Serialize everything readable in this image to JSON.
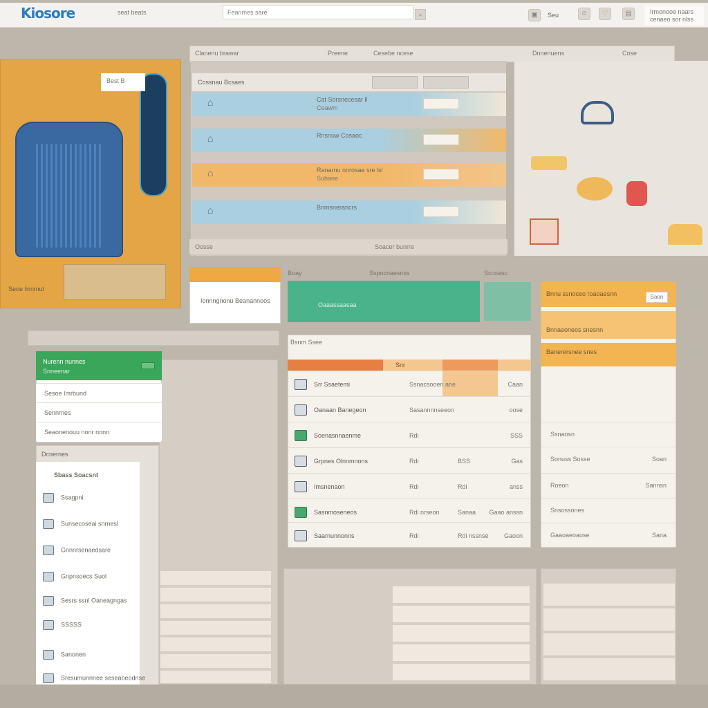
{
  "header": {
    "logo": "Kiosore",
    "top_link": "seat beats",
    "search_placeholder": "Feanmes sare",
    "account_line1": "Irmonooe naars",
    "account_line2": "cenaeo sor nlss"
  },
  "promo": {
    "label": "Best B",
    "footer": "Seoe Irrnmut"
  },
  "deals": {
    "tabs": [
      "Clanenu brawar",
      "Preene",
      "Cesebe ncese",
      "Dnnenuens",
      "Cose"
    ],
    "header": "Cossnau Bcsaes",
    "items": [
      {
        "title": "Cat Sorsnecesar ll",
        "sub": "Ceawm",
        "style": "blue"
      },
      {
        "title": "Rnsnuw Cosaoc",
        "sub": "",
        "style": "blue2"
      },
      {
        "title": "Ranarnu onrosae sre lsl",
        "sub": "Suhane",
        "style": "orange"
      },
      {
        "title": "Bnmsnerancrs",
        "sub": "",
        "style": "blue"
      }
    ],
    "footer_left": "Oosse",
    "footer_mid": "Soacer bunrre"
  },
  "cards": {
    "orange_card_text": "Ionnngnonu Beanannoos",
    "labels": [
      "Boay",
      "Sspocnaesnss",
      "Sccnasc"
    ],
    "teal_text": "Oaaassaasaa"
  },
  "list_card": {
    "title": "Nurenn nunnes",
    "subtitle": "Snneenar",
    "rows": [
      "Sesoe Imrbund",
      "Sennrnes",
      "Seaonenouu nonr nnnn"
    ]
  },
  "categories": {
    "title": "Dcnernes",
    "heading": "Sbass Soacsnt",
    "items": [
      "Ssagpni",
      "Sunsecoseai snrnesl",
      "Gnnnrsenaedsare",
      "Gnpnsoecs Suol",
      "Sesrs ssnl Oaneagngas",
      "SSSSS",
      "Sanonen",
      "Sresumunnnee seseaoeodnse"
    ]
  },
  "table": {
    "title": "Bsnm Ssee",
    "head_highlight": "Snr",
    "rows": [
      {
        "name": "Srr Ssaetemi",
        "c2": "Ssnacsooen ane",
        "c3": "",
        "c4": "Caan"
      },
      {
        "name": "Oanaan Banegeon",
        "c2": "Sasannnnseeon",
        "c3": "",
        "c4": "oose"
      },
      {
        "name": "Soenasnnaenme",
        "c2": "Rdi",
        "c3": "",
        "c4": "SSS"
      },
      {
        "name": "Grpnes Olnnmnons",
        "c2": "Rdi",
        "c3": "BSS",
        "c4": "Gas"
      },
      {
        "name": "Imsnenaon",
        "c2": "Rdi",
        "c3": "Rdi",
        "c4": "anss"
      },
      {
        "name": "Sasnmoseneos",
        "c2": "Rdi nrseon",
        "c3": "Sanaa",
        "c4": "Gaao anssn"
      },
      {
        "name": "Saarnunnonns",
        "c2": "Rdi",
        "c3": "Rdi nssnse",
        "c4": "Gaoon"
      }
    ]
  },
  "checkout": {
    "header": "Bnnu ssnoceo roaoaesnn",
    "button": "Saon",
    "row1": "Bnnaeoneos snesnn",
    "row2": "Banerersnee snes",
    "lines": [
      {
        "label": "Ssnaosn",
        "value": ""
      },
      {
        "label": "Sonuss Sosse",
        "value": "Soan"
      },
      {
        "label": "Roeon",
        "value": "Sannsn"
      },
      {
        "label": "Snsossones",
        "value": ""
      },
      {
        "label": "Gaaoaeoaose",
        "value": "Sana"
      }
    ]
  },
  "colors": {
    "accent_orange": "#f0a843",
    "accent_green": "#3aa65a",
    "accent_teal": "#4ab38c",
    "accent_blue": "#a9cfe0"
  }
}
